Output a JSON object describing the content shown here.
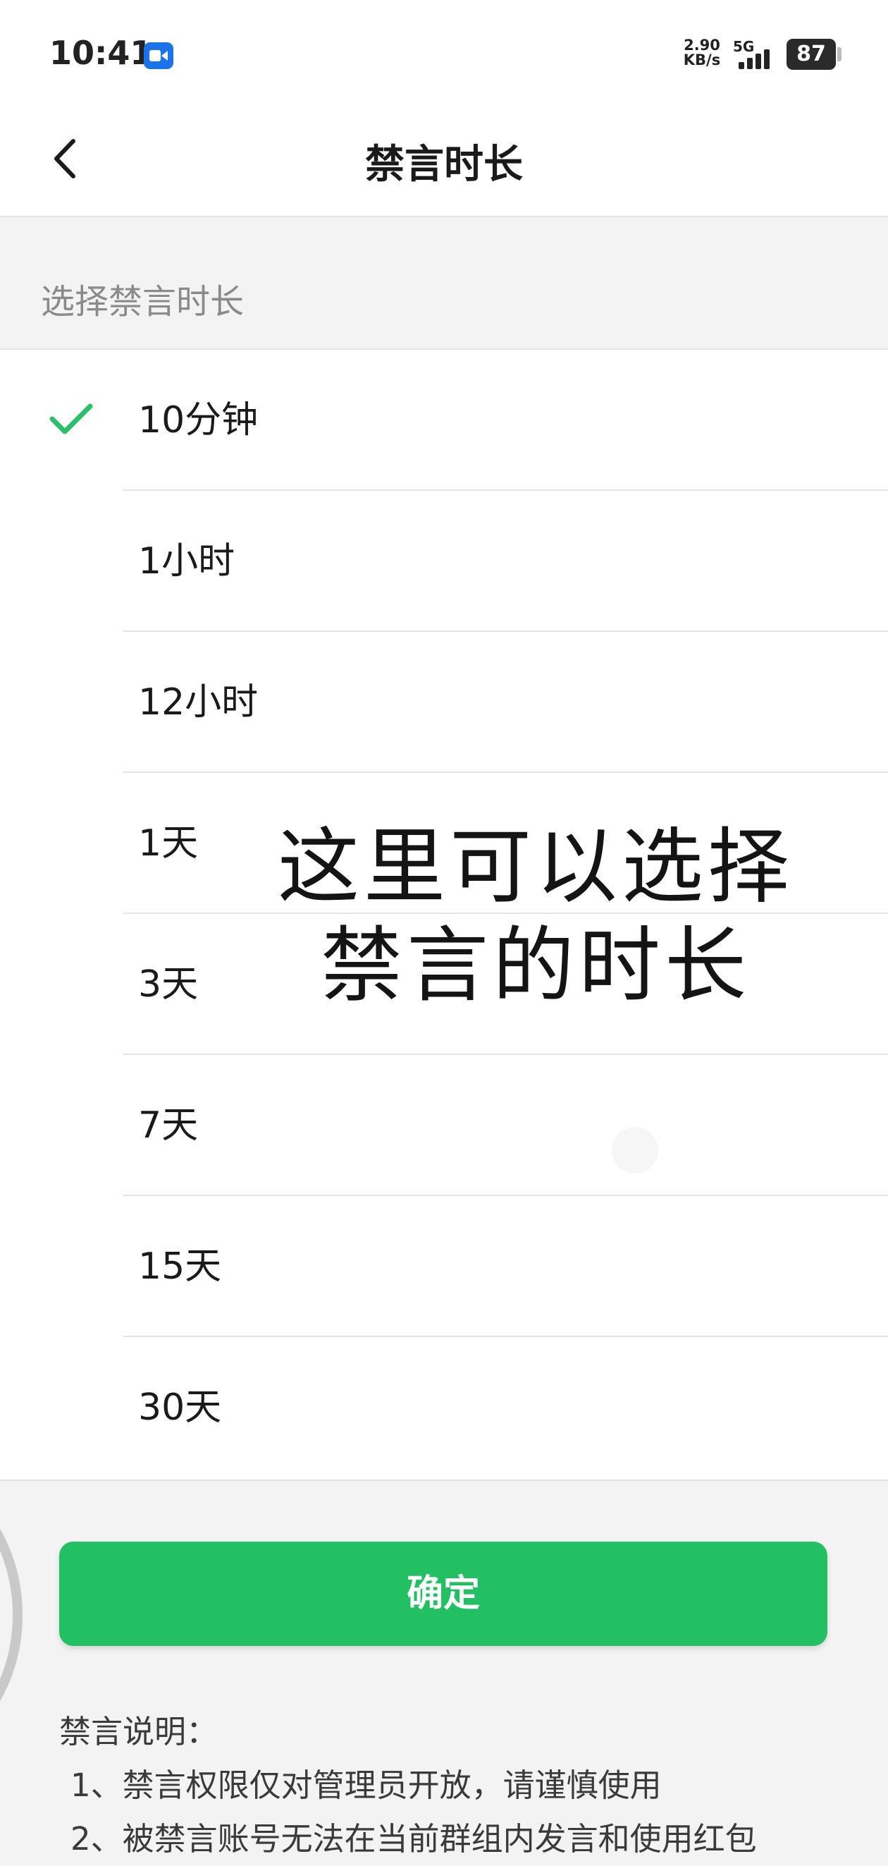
{
  "status_bar": {
    "time": "10:41",
    "recording_icon": "screen-record-icon",
    "net_speed_value": "2.90",
    "net_speed_unit": "KB/s",
    "network_type": "5G",
    "battery_level": "87"
  },
  "header": {
    "back_icon": "chevron-left-icon",
    "title": "禁言时长"
  },
  "section": {
    "label": "选择禁言时长"
  },
  "options": [
    {
      "label": "10分钟",
      "selected": true
    },
    {
      "label": "1小时",
      "selected": false
    },
    {
      "label": "12小时",
      "selected": false
    },
    {
      "label": "1天",
      "selected": false
    },
    {
      "label": "3天",
      "selected": false
    },
    {
      "label": "7天",
      "selected": false
    },
    {
      "label": "15天",
      "selected": false
    },
    {
      "label": "30天",
      "selected": false
    }
  ],
  "overlay": {
    "line1": "这里可以选择",
    "line2": "禁言的时长"
  },
  "confirm_button": {
    "label": "确定"
  },
  "notes": {
    "title": "禁言说明：",
    "items": [
      "1、禁言权限仅对管理员开放，请谨慎使用",
      "2、被禁言账号无法在当前群组内发言和使用红包"
    ]
  },
  "colors": {
    "accent_green": "#22c062",
    "check_green": "#2bbf6a",
    "background": "#f3f3f3"
  }
}
